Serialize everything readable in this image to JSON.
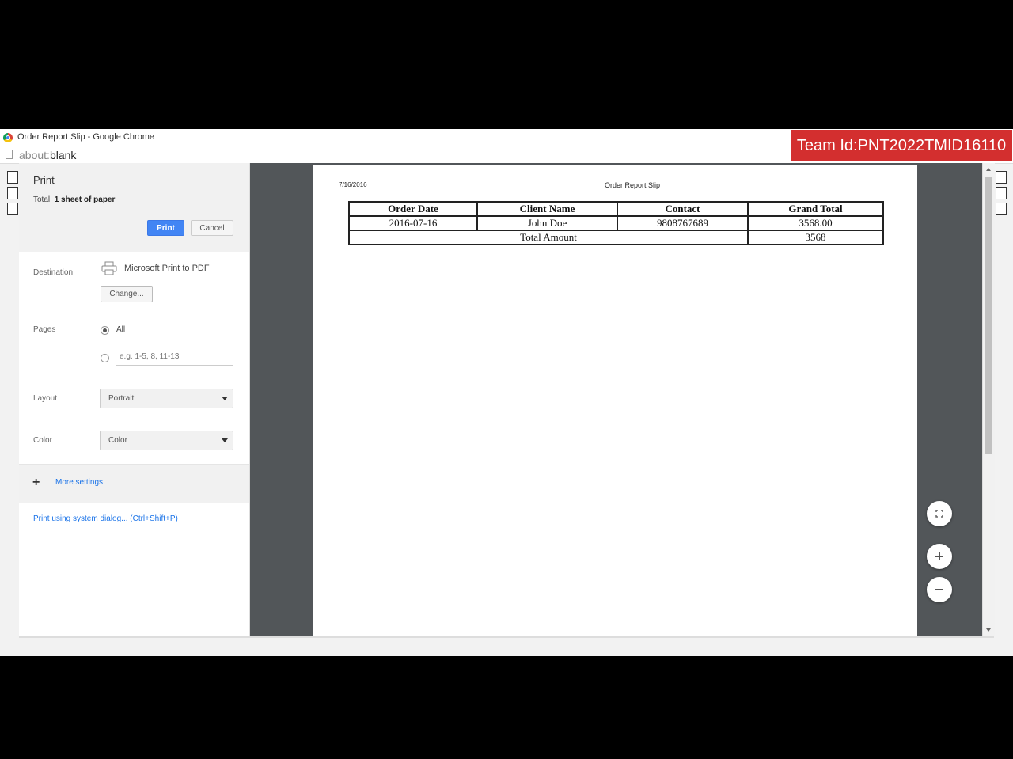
{
  "window": {
    "title": "Order Report Slip - Google Chrome",
    "url_scheme": "about:",
    "url_rest": "blank"
  },
  "overlay": {
    "team_id": "Team Id:PNT2022TMID16110",
    "badge_color": "#d32f2f"
  },
  "print_panel": {
    "title": "Print",
    "total_label": "Total:",
    "total_value": "1 sheet of paper",
    "print_button": "Print",
    "cancel_button": "Cancel",
    "destination_label": "Destination",
    "destination_value": "Microsoft Print to PDF",
    "destination_icon": "printer-icon",
    "change_button": "Change...",
    "pages_label": "Pages",
    "pages_all": "All",
    "pages_placeholder": "e.g. 1-5, 8, 11-13",
    "layout_label": "Layout",
    "layout_value": "Portrait",
    "color_label": "Color",
    "color_value": "Color",
    "more_settings": "More settings",
    "system_dialog": "Print using system dialog... (Ctrl+Shift+P)",
    "accent_color": "#4285f4"
  },
  "preview": {
    "date": "7/16/2016",
    "title": "Order Report Slip",
    "table": {
      "headers": [
        "Order Date",
        "Client Name",
        "Contact",
        "Grand Total"
      ],
      "rows": [
        [
          "2016-07-16",
          "John Doe",
          "9808767689",
          "3568.00"
        ]
      ],
      "total_label": "Total Amount",
      "total_value": "3568"
    },
    "zoom_icons": [
      "fit-to-page-icon",
      "zoom-in-icon",
      "zoom-out-icon"
    ]
  }
}
